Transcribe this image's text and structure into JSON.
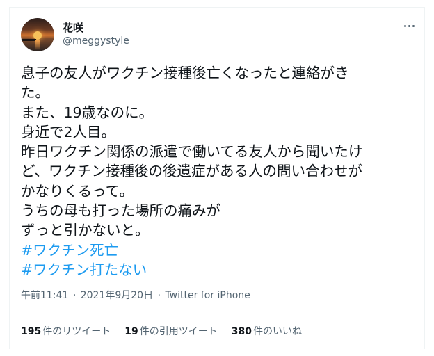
{
  "user": {
    "display_name": "花咲",
    "handle": "@meggystyle"
  },
  "tweet": {
    "lines": [
      "息子の友人がワクチン接種後亡くなったと連絡がき",
      "た。",
      "また、19歳なのに。",
      "身近で2人目。",
      "昨日ワクチン関係の派遣で働いてる友人から聞いたけ",
      "ど、ワクチン接種後の後遺症がある人の問い合わせが",
      "かなりくるって。",
      "うちの母も打った場所の痛みが",
      "ずっと引かないと。"
    ],
    "hashtags": [
      "#ワクチン死亡",
      "#ワクチン打たない"
    ]
  },
  "meta": {
    "time": "午前11:41",
    "separator": "·",
    "date": "2021年9月20日",
    "source": "Twitter for iPhone"
  },
  "stats": {
    "retweets_count": "195",
    "retweets_label": "件のリツイート",
    "quotes_count": "19",
    "quotes_label": "件の引用ツイート",
    "likes_count": "380",
    "likes_label": "件のいいね"
  },
  "colors": {
    "text": "#0f1419",
    "secondary": "#536471",
    "link": "#1d9bf0",
    "border": "#eff3f4"
  },
  "icons": {
    "more": "more-horizontal-icon"
  }
}
